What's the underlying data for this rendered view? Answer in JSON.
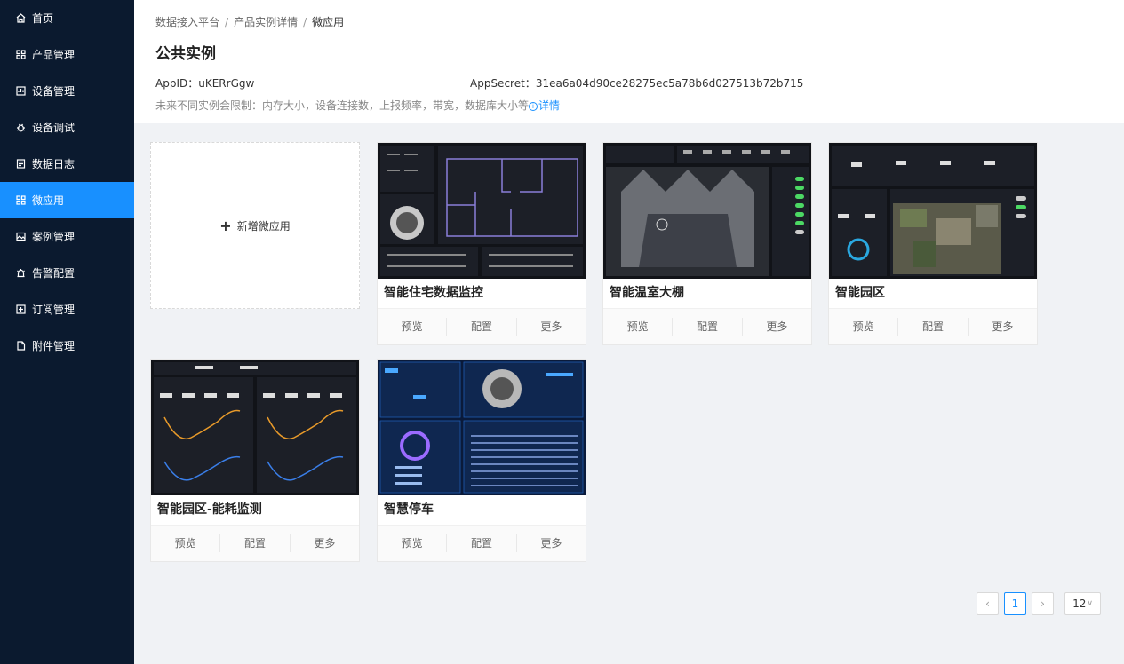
{
  "sidebar": {
    "items": [
      {
        "label": "首页",
        "icon": "home-icon",
        "active": false
      },
      {
        "label": "产品管理",
        "icon": "grid-icon",
        "active": false
      },
      {
        "label": "设备管理",
        "icon": "device-icon",
        "active": false
      },
      {
        "label": "设备调试",
        "icon": "bug-icon",
        "active": false
      },
      {
        "label": "数据日志",
        "icon": "log-icon",
        "active": false
      },
      {
        "label": "微应用",
        "icon": "apps-icon",
        "active": true
      },
      {
        "label": "案例管理",
        "icon": "image-icon",
        "active": false
      },
      {
        "label": "告警配置",
        "icon": "alarm-icon",
        "active": false
      },
      {
        "label": "订阅管理",
        "icon": "subscribe-icon",
        "active": false
      },
      {
        "label": "附件管理",
        "icon": "file-icon",
        "active": false
      }
    ],
    "accent": "#1890ff",
    "background": "#0b1a2f"
  },
  "breadcrumb": [
    "数据接入平台",
    "产品实例详情",
    "微应用"
  ],
  "breadcrumb_sep": "/",
  "header": {
    "title": "公共实例",
    "appid_label": "AppID：",
    "appid_value": "uKERrGgw",
    "appsecret_label": "AppSecret：",
    "appsecret_value": "31ea6a04d90ce28275ec5a78b6d027513b72b715",
    "limit_note": "未来不同实例会限制：内存大小，设备连接数，上报频率，带宽，数据库大小等",
    "info_glyph": "i",
    "detail_link": "详情"
  },
  "add_card": {
    "plus": "+",
    "label": "新增微应用"
  },
  "actions": {
    "preview": "预览",
    "config": "配置",
    "more": "更多"
  },
  "cards": [
    {
      "title": "智能住宅数据监控",
      "thumb": "thumb-residential"
    },
    {
      "title": "智能温室大棚",
      "thumb": "thumb-greenhouse"
    },
    {
      "title": "智能园区",
      "thumb": "thumb-park"
    },
    {
      "title": "智能园区-能耗监测",
      "thumb": "thumb-energy"
    },
    {
      "title": "智慧停车",
      "thumb": "thumb-parking"
    }
  ],
  "pagination": {
    "prev": "‹",
    "current": "1",
    "next": "›",
    "page_size": "12",
    "size_chevron": "∨"
  }
}
